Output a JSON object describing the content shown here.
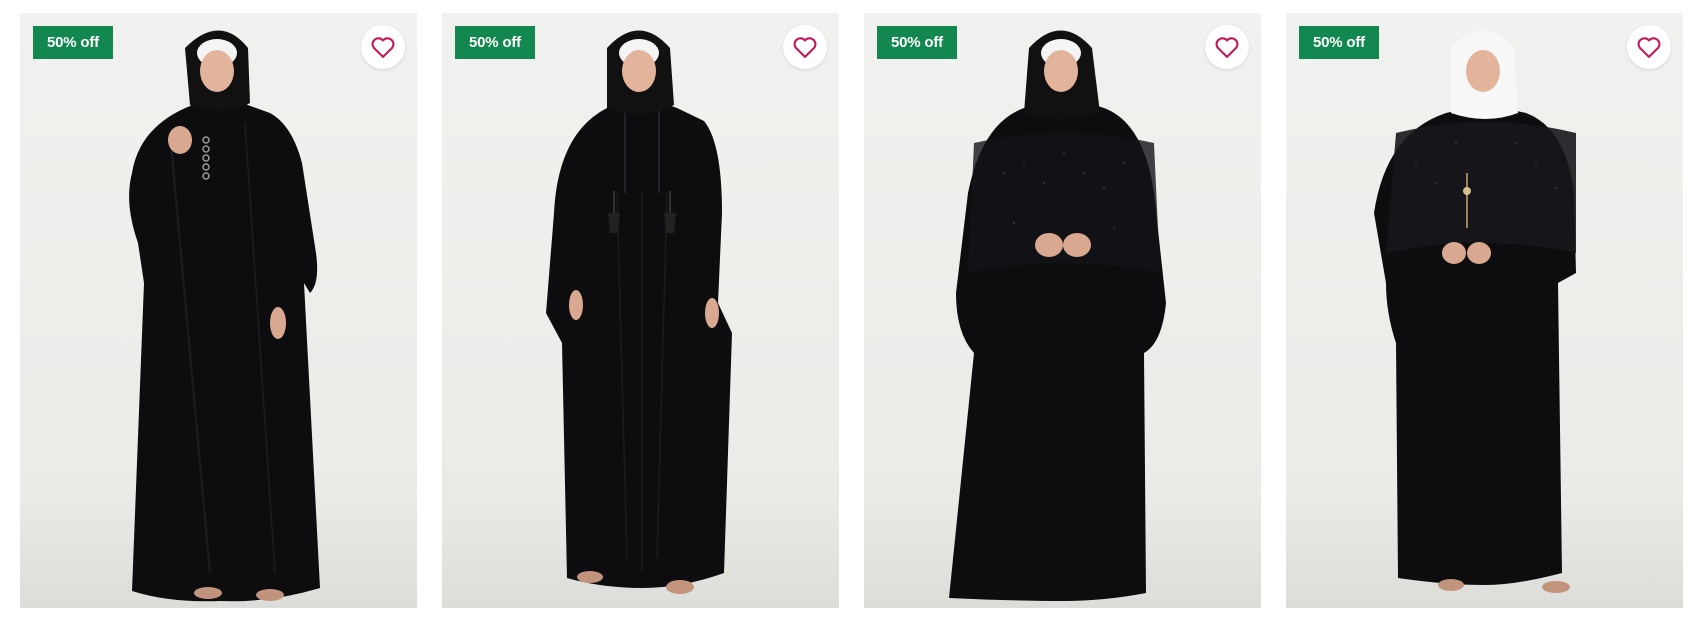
{
  "products": [
    {
      "badge": "50% off",
      "wishlist_icon": "heart-outline-icon",
      "hijab_color": "#111111",
      "inner_scarf": "#f4f4f4"
    },
    {
      "badge": "50% off",
      "wishlist_icon": "heart-outline-icon",
      "hijab_color": "#111111",
      "inner_scarf": "#f4f4f4"
    },
    {
      "badge": "50% off",
      "wishlist_icon": "heart-outline-icon",
      "hijab_color": "#111111",
      "inner_scarf": "#f4f4f4"
    },
    {
      "badge": "50% off",
      "wishlist_icon": "heart-outline-icon",
      "hijab_color": "#f7f7f7",
      "inner_scarf": "#f7f7f7"
    }
  ],
  "colors": {
    "badge_bg": "#12874f",
    "heart": "#c2185b",
    "garment": "#0d0d0f"
  }
}
